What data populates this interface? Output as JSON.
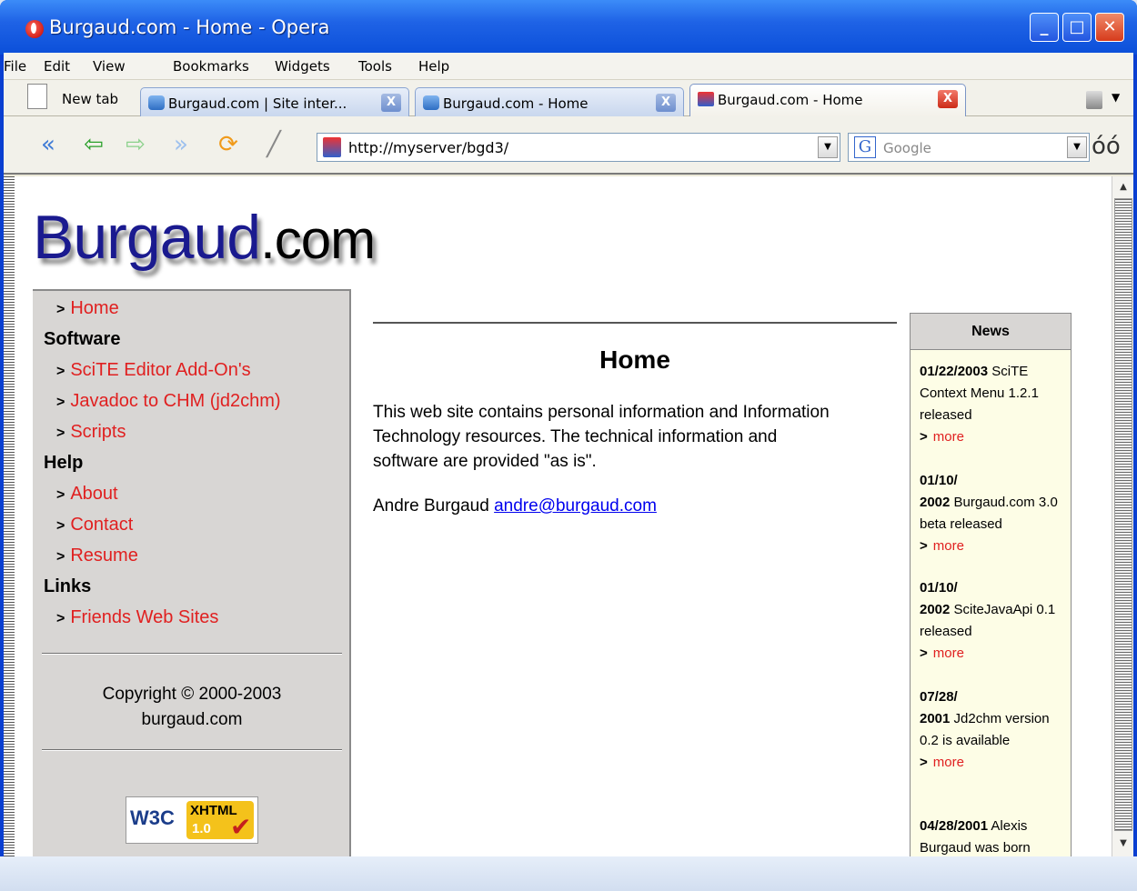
{
  "window": {
    "title": "Burgaud.com - Home - Opera"
  },
  "menu": [
    "File",
    "Edit",
    "View",
    "Bookmarks",
    "Widgets",
    "Tools",
    "Help"
  ],
  "tabs": {
    "new_tab": "New tab",
    "items": [
      {
        "label": "Burgaud.com | Site inter..."
      },
      {
        "label": "Burgaud.com - Home"
      },
      {
        "label": "Burgaud.com - Home"
      }
    ],
    "close_glyph": "X"
  },
  "toolbar": {
    "address": "http://myserver/bgd3/",
    "search_placeholder": "Google",
    "search_engine_glyph": "G"
  },
  "site": {
    "logo_main": "Burgaud",
    "logo_tld": ".com",
    "nav": [
      {
        "type": "link",
        "label": "Home"
      },
      {
        "type": "head",
        "label": "Software"
      },
      {
        "type": "link",
        "label": "SciTE Editor Add-On's"
      },
      {
        "type": "link",
        "label": "Javadoc to CHM (jd2chm)"
      },
      {
        "type": "link",
        "label": "Scripts"
      },
      {
        "type": "head",
        "label": "Help"
      },
      {
        "type": "link",
        "label": "About"
      },
      {
        "type": "link",
        "label": "Contact"
      },
      {
        "type": "link",
        "label": "Resume"
      },
      {
        "type": "head",
        "label": "Links"
      },
      {
        "type": "link",
        "label": "Friends Web Sites"
      }
    ],
    "nav_arrow": ">",
    "copyright_line1": "Copyright © 2000-2003",
    "copyright_line2": "burgaud.com",
    "badge": {
      "left": "W3C",
      "xhtml": "XHTML",
      "version": "1.0"
    },
    "main": {
      "title": "Home",
      "paragraph": "This web site contains personal information and Information Technology resources. The technical information and software are provided \"as is\".",
      "author_name": "Andre Burgaud",
      "author_email": "andre@burgaud.com"
    },
    "news": {
      "heading": "News",
      "more_label": "more",
      "items": [
        {
          "date": "01/22/2003",
          "text": "SciTE Context Menu 1.2.1 released"
        },
        {
          "date": "01/10/\n2002",
          "text": "Burgaud.com 3.0 beta released"
        },
        {
          "date": "01/10/\n2002",
          "text": "SciteJavaApi 0.1 released"
        },
        {
          "date": "07/28/\n2001",
          "text": "Jd2chm version 0.2 is available"
        },
        {
          "date": "04/28/2001",
          "text": "Alexis Burgaud was born"
        }
      ]
    }
  }
}
